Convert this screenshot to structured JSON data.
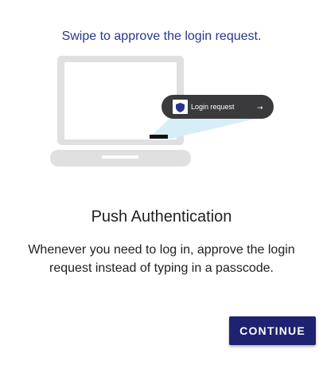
{
  "header": {
    "subtitle": "Swipe to approve the login request."
  },
  "illustration": {
    "notification_text": "Login request",
    "notification_arrow": "→",
    "shield_icon": "shield-icon",
    "laptop_icon": "laptop-icon"
  },
  "main": {
    "title": "Push Authentication",
    "description": "Whenever you need to log in, approve the login request instead of typing in a passcode."
  },
  "actions": {
    "continue_label": "CONTINUE"
  },
  "colors": {
    "accent": "#283593",
    "button": "#1f2270",
    "laptop": "#e0e0e0",
    "notification": "#3a3a3c",
    "beam": "#d7eef6"
  }
}
